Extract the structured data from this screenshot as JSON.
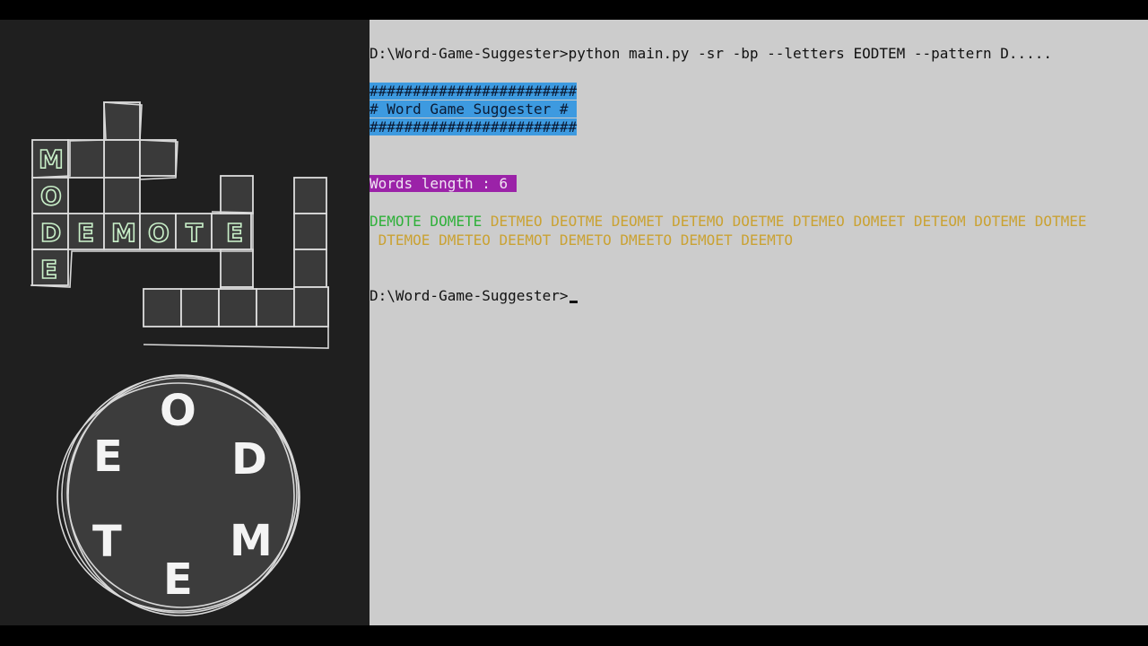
{
  "terminal": {
    "prompt": "D:\\Word-Game-Suggester>",
    "command": "python main.py -sr -bp --letters EODTEM --pattern D.....",
    "banner": {
      "border": "########################",
      "title": "# Word Game Suggester #"
    },
    "words_length_label": "Words length : 6",
    "results_line1_green": "DEMOTE DOMETE",
    "results_line1_gold": " DETMEO DEOTME DEOMET DETEMO DOETME DTEMEO DOMEET DETEOM DOTEME DOTMEE",
    "results_line2_gold": " DTEMOE DMETEO DEEMOT DEMETO DMEETO DEMOET DEEMTO",
    "final_prompt": "D:\\Word-Game-Suggester>"
  },
  "puzzle": {
    "vertical_word": "MODE",
    "horizontal_word": "DEMOTE",
    "wheel_letters": [
      "O",
      "D",
      "M",
      "E",
      "T",
      "E"
    ]
  },
  "colors": {
    "green": "#2fb03a",
    "gold": "#caa233",
    "banner_bg": "#3d9ae0",
    "label_bg": "#9b22a8",
    "terminal_bg": "#cccccc"
  }
}
